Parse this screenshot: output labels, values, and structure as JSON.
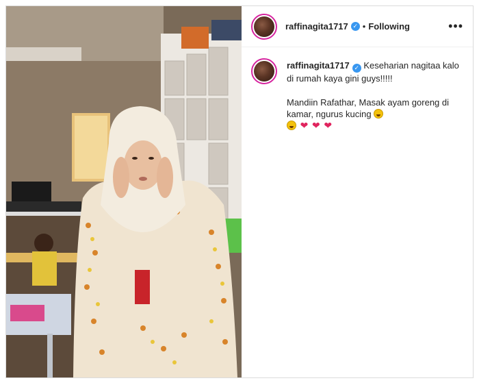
{
  "post": {
    "username": "raffinagita1717",
    "separator": "•",
    "follow_label": "Following",
    "more_label": "•••"
  },
  "caption": {
    "username": "raffinagita1717",
    "line1": "Keseharian nagitaa kalo di rumah kaya gini guys!!!!!",
    "line2": "Mandiin Rafathar, Masak ayam goreng di kamar, ngurus kucing",
    "heart": "❤"
  },
  "colors": {
    "story_ring": "#d6249f",
    "verified": "#3897f0",
    "heart": "#e0245e"
  },
  "icons": {
    "verified": "verified-badge-icon",
    "more": "more-options-icon"
  }
}
